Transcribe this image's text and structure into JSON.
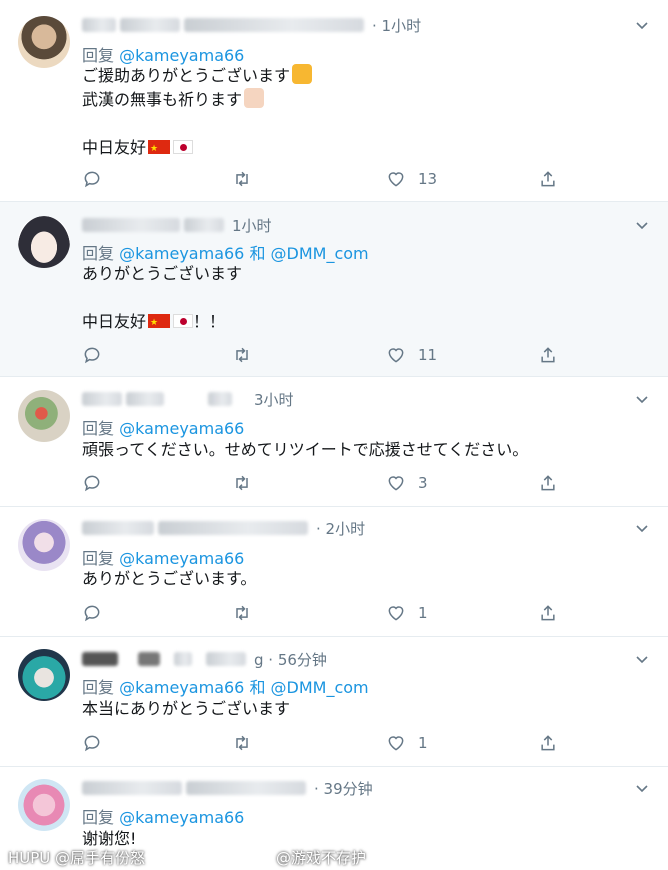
{
  "tweets": [
    {
      "time": "· 1小时",
      "reply_prefix": "回复",
      "mentions": "@kameyama66",
      "lines": [
        "ご援助ありがとうございます",
        "武漢の無事も祈ります",
        "",
        "中日友好"
      ],
      "counts": {
        "reply": "",
        "retweet": "",
        "like": "13"
      }
    },
    {
      "time": "1小时",
      "reply_prefix": "回复",
      "mentions": "@kameyama66 和 @DMM_com",
      "lines": [
        "ありがとうございます",
        "",
        "中日友好",
        "！！"
      ],
      "counts": {
        "reply": "",
        "retweet": "",
        "like": "11"
      }
    },
    {
      "time": "3小时",
      "reply_prefix": "回复",
      "mentions": "@kameyama66",
      "lines": [
        "頑張ってください。せめてリツイートで応援させてください。"
      ],
      "counts": {
        "reply": "",
        "retweet": "",
        "like": "3"
      }
    },
    {
      "time": "· 2小时",
      "reply_prefix": "回复",
      "mentions": "@kameyama66",
      "lines": [
        "ありがとうございます。"
      ],
      "counts": {
        "reply": "",
        "retweet": "",
        "like": "1"
      }
    },
    {
      "time": "g · 56分钟",
      "reply_prefix": "回复",
      "mentions": "@kameyama66 和 @DMM_com",
      "lines": [
        "本当にありがとうございます"
      ],
      "counts": {
        "reply": "",
        "retweet": "",
        "like": "1"
      }
    },
    {
      "time": "· 39分钟",
      "reply_prefix": "回复",
      "mentions": "@kameyama66",
      "lines": [
        "谢谢您!"
      ],
      "counts": {
        "reply": "",
        "retweet": "",
        "like": ""
      }
    }
  ],
  "watermarks": {
    "left": "HUPU @屌手有份怒",
    "right": "@游戏不存护"
  },
  "icons": {
    "reply": "reply-icon",
    "retweet": "retweet-icon",
    "like": "heart-icon",
    "share": "share-icon",
    "menu": "chevron-down-icon"
  },
  "colors": {
    "link": "#1b95e0",
    "meta": "#657786",
    "shaded": "#f5f8fa",
    "divider": "#e6ecf0"
  }
}
